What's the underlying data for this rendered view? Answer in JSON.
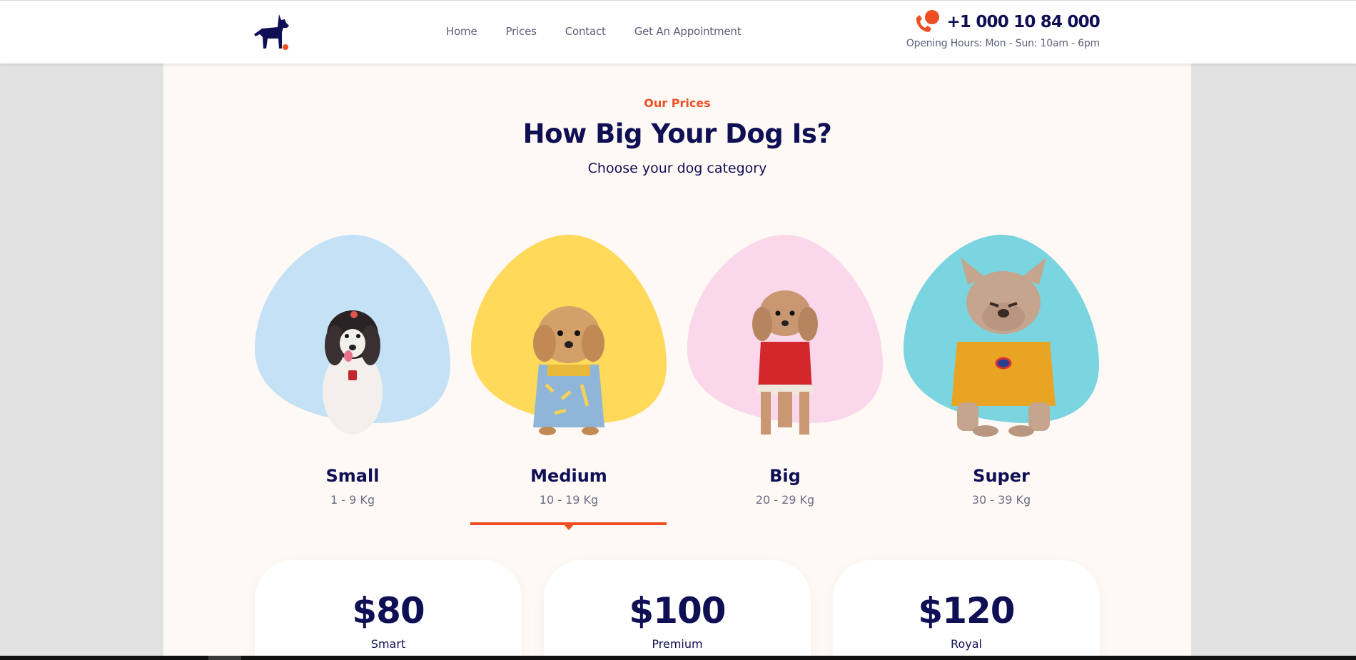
{
  "header": {
    "nav": [
      "Home",
      "Prices",
      "Contact",
      "Get An Appointment"
    ],
    "phone": "+1 000 10 84 000",
    "hours": "Opening Hours: Mon - Sun: 10am - 6pm"
  },
  "hero": {
    "eyebrow": "Our Prices",
    "title": "How Big Your Dog Is?",
    "subtitle": "Choose your dog category"
  },
  "dogs": [
    {
      "name": "Small",
      "weight": "1 - 9 Kg",
      "blob_color": "#c4e1f6",
      "selected": false
    },
    {
      "name": "Medium",
      "weight": "10 - 19 Kg",
      "blob_color": "#ffd95a",
      "selected": true
    },
    {
      "name": "Big",
      "weight": "20 - 29 Kg",
      "blob_color": "#fad7ea",
      "selected": false
    },
    {
      "name": "Super",
      "weight": "30 - 39 Kg",
      "blob_color": "#7ad5e0",
      "selected": false
    }
  ],
  "plans": [
    {
      "price": "$80",
      "name": "Smart"
    },
    {
      "price": "$100",
      "name": "Premium"
    },
    {
      "price": "$120",
      "name": "Royal"
    }
  ],
  "colors": {
    "navy": "#0f0f55",
    "accent": "#f04e23",
    "section_bg": "#fff9f5",
    "page_bg": "#e2e2e2"
  },
  "icons": {
    "logo": "dog-silhouette-icon",
    "phone": "phone-icon"
  }
}
